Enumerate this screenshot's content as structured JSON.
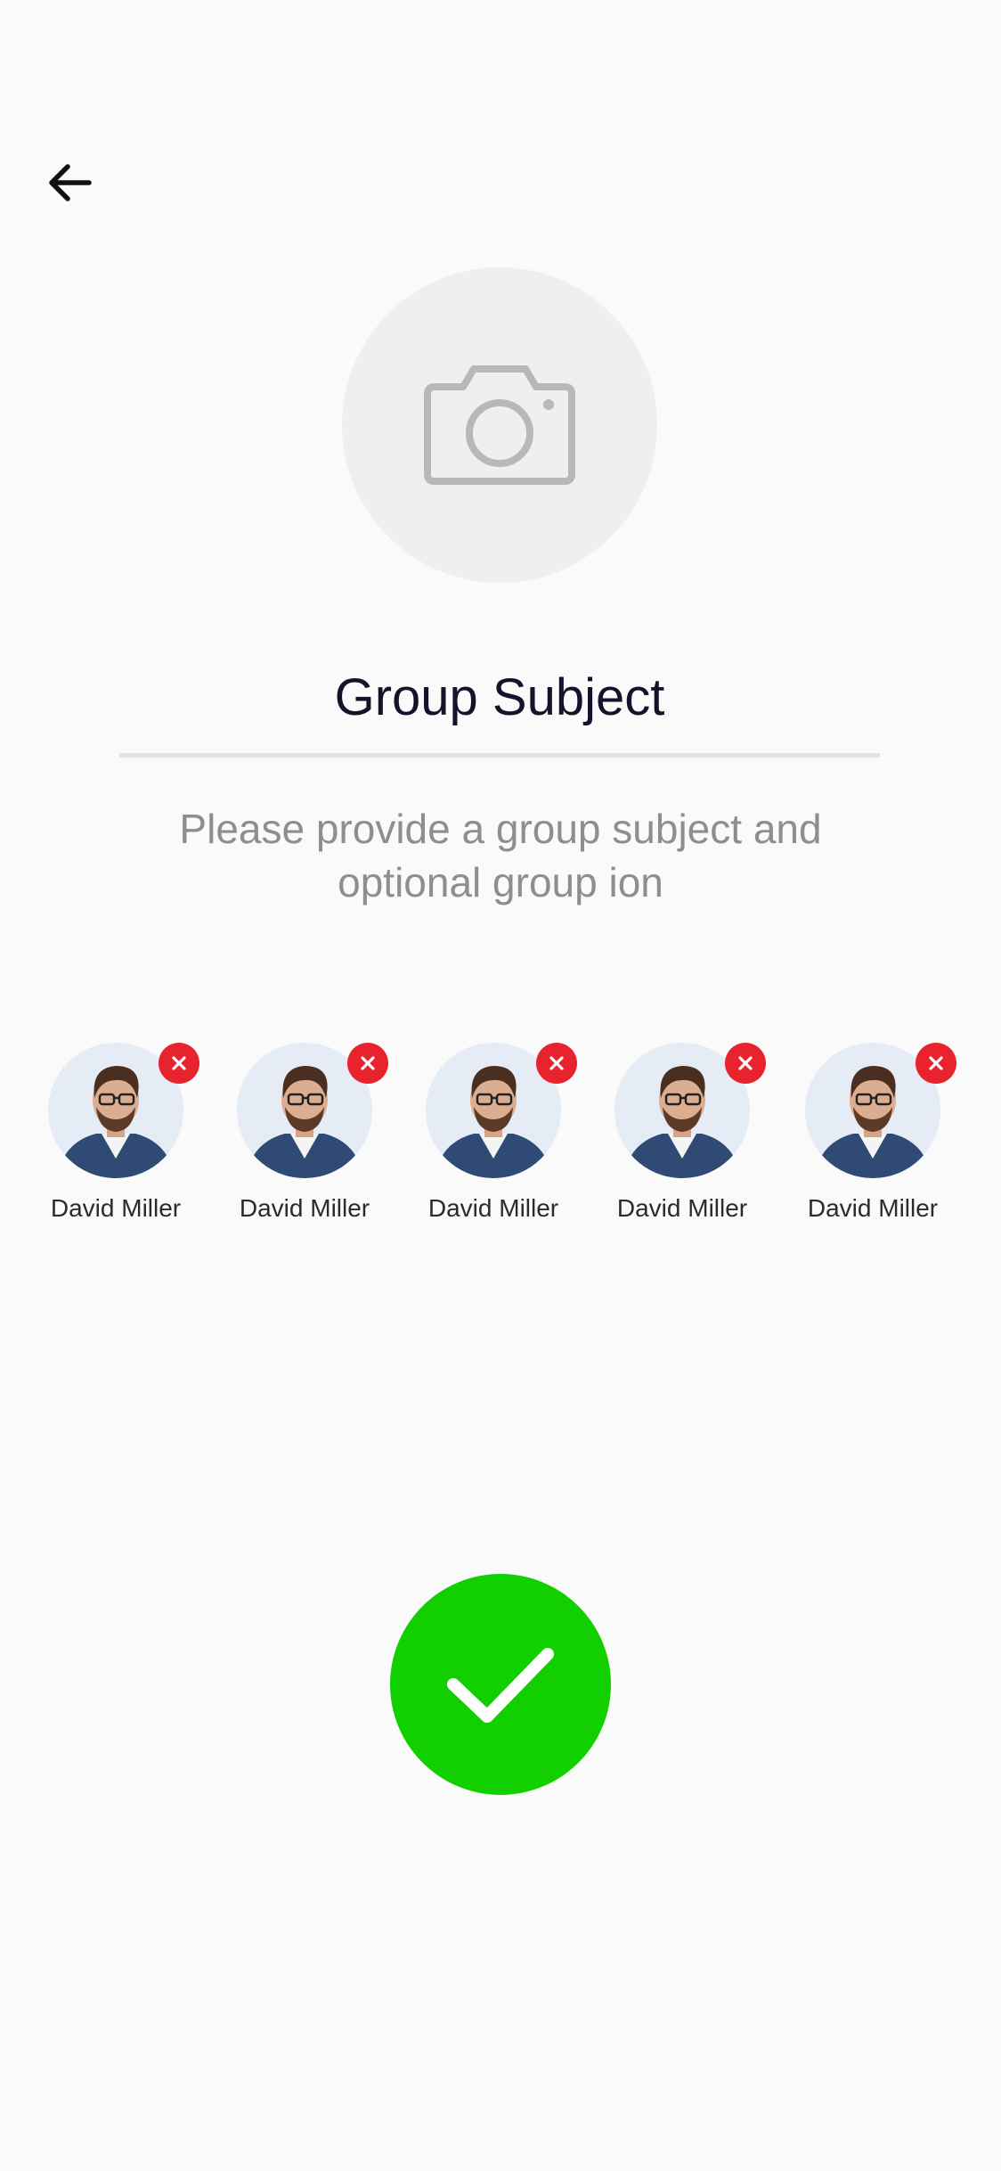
{
  "header": {
    "back_icon": "arrow-left-icon"
  },
  "group": {
    "photo_icon": "camera-icon",
    "subject_placeholder": "Group Subject",
    "hint": "Please provide a group subject and optional group ion"
  },
  "members": [
    {
      "name": "David Miller"
    },
    {
      "name": "David Miller"
    },
    {
      "name": "David Miller"
    },
    {
      "name": "David Miller"
    },
    {
      "name": "David Miller"
    }
  ],
  "actions": {
    "confirm_icon": "checkmark-icon",
    "remove_icon": "close-icon"
  },
  "colors": {
    "background": "#fafafa",
    "confirm": "#12d000",
    "remove": "#e8232d",
    "title": "#15132b",
    "hint": "#8e8e8e"
  }
}
